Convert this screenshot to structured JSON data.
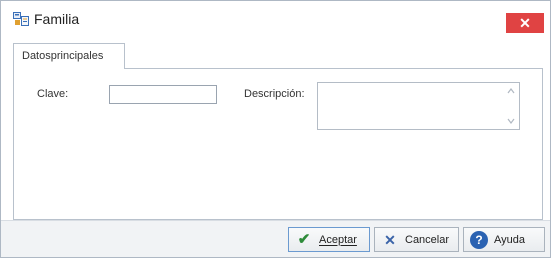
{
  "window": {
    "title": "Familia",
    "close_label": "✕"
  },
  "tabs": [
    {
      "label": "Datosprincipales"
    }
  ],
  "form": {
    "clave_label": "Clave:",
    "clave_value": "",
    "descripcion_label": "Descripción:",
    "descripcion_value": ""
  },
  "buttons": {
    "aceptar": "Aceptar",
    "cancelar": "Cancelar",
    "ayuda": "Ayuda"
  },
  "icons": {
    "app": "window-app-icon",
    "close": "close-icon",
    "aceptar": "check-icon",
    "cancelar": "x-icon",
    "ayuda": "help-icon"
  },
  "colors": {
    "close_button": "#e04343",
    "help_icon": "#2a62b2",
    "check_icon": "#2e8b3a"
  }
}
